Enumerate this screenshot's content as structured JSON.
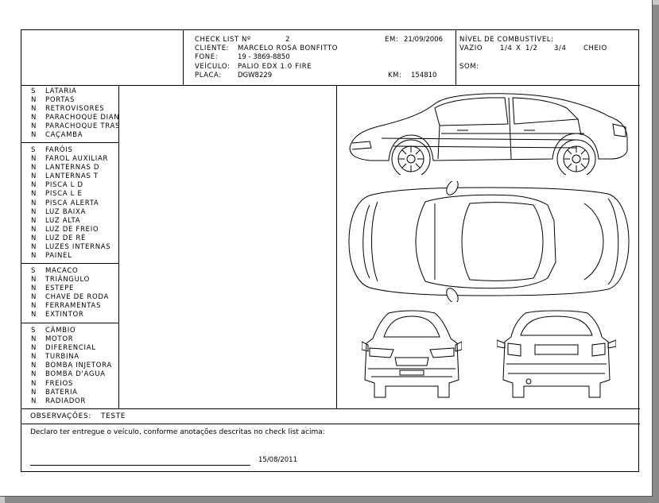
{
  "header": {
    "checklist_label": "CHECK LIST Nº",
    "checklist_number": "2",
    "date_label": "EM:",
    "date_value": "21/09/2006",
    "client_label": "CLIENTE:",
    "client_value": "MARCELO ROSA BONFITTO",
    "phone_label": "FONE:",
    "phone_value": "19 - 3869-8850",
    "vehicle_label": "VEÍCULO:",
    "vehicle_value": "PALIO EDX 1.0 FIRE",
    "plate_label": "PLACA:",
    "plate_value": "DGW8229",
    "km_label": "KM:",
    "km_value": "154810"
  },
  "fuel": {
    "title": "NÍVEL DE COMBUSTÍVEL:",
    "empty": "VAZIO",
    "quarter": "1/4",
    "marker": "X",
    "half": "1/2",
    "three_quarters": "3/4",
    "full": "CHEIO",
    "sound_label": "SOM:"
  },
  "checklist": {
    "body": [
      {
        "status": "S",
        "label": "LATARIA"
      },
      {
        "status": "N",
        "label": "PORTAS"
      },
      {
        "status": "N",
        "label": "RETROVISORES"
      },
      {
        "status": "N",
        "label": "PARACHOQUE DIAN"
      },
      {
        "status": "N",
        "label": "PARACHOQUE TRAS"
      },
      {
        "status": "N",
        "label": "CAÇAMBA"
      }
    ],
    "lights": [
      {
        "status": "S",
        "label": "FARÓIS"
      },
      {
        "status": "N",
        "label": "FAROL AUXILIAR"
      },
      {
        "status": "N",
        "label": "LANTERNAS D"
      },
      {
        "status": "N",
        "label": "LANTERNAS T"
      },
      {
        "status": "N",
        "label": "PISCA L D"
      },
      {
        "status": "N",
        "label": "PISCA L E"
      },
      {
        "status": "N",
        "label": "PISCA ALERTA"
      },
      {
        "status": "N",
        "label": "LUZ BAIXA"
      },
      {
        "status": "N",
        "label": "LUZ ALTA"
      },
      {
        "status": "N",
        "label": "LUZ DE FREIO"
      },
      {
        "status": "N",
        "label": "LUZ DE RÉ"
      },
      {
        "status": "N",
        "label": "LUZES INTERNAS"
      },
      {
        "status": "N",
        "label": "PAINEL"
      }
    ],
    "tools": [
      {
        "status": "S",
        "label": "MACACO"
      },
      {
        "status": "N",
        "label": "TRIÂNGULO"
      },
      {
        "status": "N",
        "label": "ESTEPE"
      },
      {
        "status": "N",
        "label": "CHAVE DE RODA"
      },
      {
        "status": "N",
        "label": "FERRAMENTAS"
      },
      {
        "status": "N",
        "label": "EXTINTOR"
      }
    ],
    "mechanical": [
      {
        "status": "S",
        "label": "CÂMBIO"
      },
      {
        "status": "N",
        "label": "MOTOR"
      },
      {
        "status": "N",
        "label": "DIFERENCIAL"
      },
      {
        "status": "N",
        "label": "TURBINA"
      },
      {
        "status": "N",
        "label": "BOMBA INJETORA"
      },
      {
        "status": "N",
        "label": "BOMBA D'AGUA"
      },
      {
        "status": "N",
        "label": "FREIOS"
      },
      {
        "status": "N",
        "label": "BATERIA"
      },
      {
        "status": "N",
        "label": "RADIADOR"
      }
    ]
  },
  "observations": {
    "label": "OBSERVAÇÕES:",
    "value": "TESTE"
  },
  "declaration": {
    "text": "Declaro ter entregue o veículo, conforme anotações descritas no check list acima:",
    "date": "15/08/2011"
  }
}
